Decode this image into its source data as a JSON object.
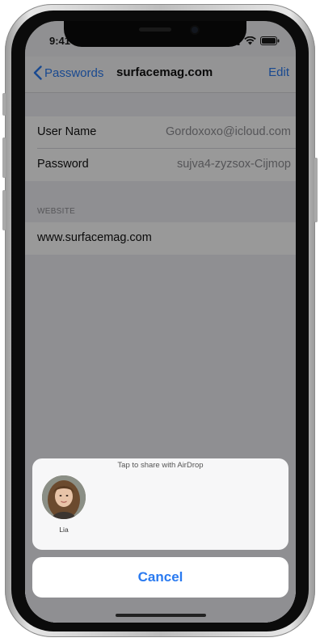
{
  "status_bar": {
    "time": "9:41"
  },
  "nav_bar": {
    "back_label": "Passwords",
    "title": "surfacemag.com",
    "edit_label": "Edit"
  },
  "credentials": [
    {
      "label": "User Name",
      "value": "Gordoxoxo@icloud.com"
    },
    {
      "label": "Password",
      "value": "sujva4-zyzsox-Cijmop"
    }
  ],
  "website_section": {
    "header": "WEBSITE",
    "url": "www.surfacemag.com"
  },
  "share_sheet": {
    "hint": "Tap to share with AirDrop",
    "contacts": [
      {
        "name": "Lia"
      }
    ],
    "cancel_label": "Cancel"
  },
  "colors": {
    "accent": "#2a7af0",
    "dim_overlay": "rgba(0,0,0,0.40)"
  }
}
